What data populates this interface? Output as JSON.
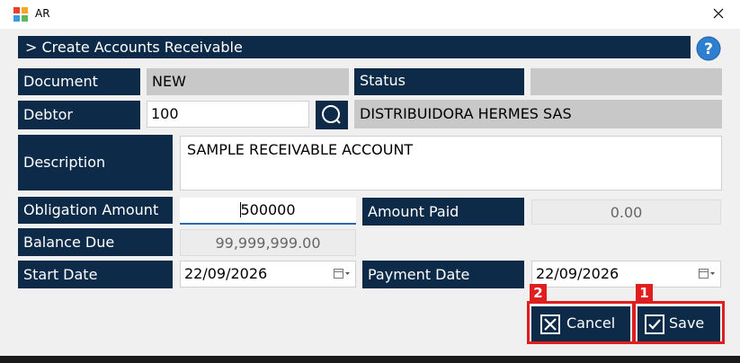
{
  "window": {
    "title": "AR"
  },
  "header": {
    "title": "> Create Accounts Receivable"
  },
  "form": {
    "document_label": "Document",
    "document_value": "NEW",
    "status_label": "Status",
    "status_value": "",
    "debtor_label": "Debtor",
    "debtor_value": "100",
    "debtor_name": "DISTRIBUIDORA HERMES SAS",
    "description_label": "Description",
    "description_value": "SAMPLE RECEIVABLE ACCOUNT",
    "obligation_label": "Obligation Amount",
    "obligation_value": "500000",
    "amount_paid_label": "Amount Paid",
    "amount_paid_value": "0.00",
    "balance_label": "Balance Due",
    "balance_value": "99,999,999.00",
    "start_date_label": "Start Date",
    "start_date_value": "22/09/2026",
    "payment_date_label": "Payment Date",
    "payment_date_value": "22/09/2026"
  },
  "actions": {
    "cancel_label": "Cancel",
    "save_label": "Save"
  },
  "annotations": {
    "cancel_badge": "2",
    "save_badge": "1"
  },
  "colors": {
    "label_bg": "#0d2b48",
    "readonly_bg": "#c8c8c8",
    "highlight": "#e01e1e",
    "help_blue": "#2f7fd0"
  },
  "icons": {
    "app": "app-logo-icon",
    "close": "close-icon",
    "help": "help-icon",
    "search": "search-icon",
    "calendar": "calendar-icon",
    "cancel": "cancel-x-icon",
    "save": "check-icon"
  }
}
